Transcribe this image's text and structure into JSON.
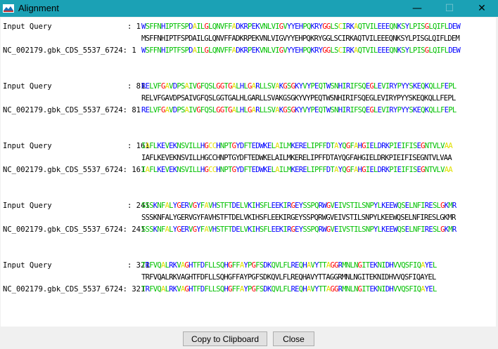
{
  "window": {
    "title": "Alignment",
    "minimize_glyph": "—",
    "maximize_glyph": "☐",
    "close_glyph": "✕"
  },
  "colors": {
    "titlebar": "#1ba1b5",
    "green": "#00c000",
    "blue": "#0000ff",
    "red": "#ff0000",
    "yellow": "#e0e000",
    "black": "#000000"
  },
  "alignment": {
    "blocks": [
      {
        "query_label": "Input Query                 : 1",
        "query_seq": "WSFFNHIPTFSPDAILGLQNVFFADKRPEKVNLVIGVYYEHPQKRYGGLSCIRKAQTVILEEEQNKSYLPISGLQIFLDEW",
        "consensus": "MSFFNHIPTFSPDAILGLQNVFFADKRPEKVNLVIGVYYEHPQKRYGGLSCIRKAQTVILEEEQNKSYLPISGLQIFLDEM",
        "subject_label": "NC_002179.gbk_CDS_5537_6724: 1",
        "subject_seq": "WSFFNHIPTFSPDAILGLQNVFFADKRPEKVNLVIGVYYEHPQKRYGGLSCIRKAQTVILEEEQNKSYLPISGLQIFLDEW"
      },
      {
        "query_label": "Input Query                 : 81",
        "query_seq": "RELVFGAVDPSAIVGFQSLGGTGALHLGARLLSVAKGSGKYVYPEQTWSNHIRIFSQEGLEVIRYPYYSKEQKQLLFEPL",
        "consensus": "RELVFGAVDPSAIVGFQSLGGTGALHLGARLLSVAKGSGKYVYPEQTWSNHIRIFSQEGLEVIRYPYYSKEQKQLLFEPL",
        "subject_label": "NC_002179.gbk_CDS_5537_6724: 81",
        "subject_seq": "RELVFGAVDPSAIVGFQSLGGTGALHLGARLLSVAKGSGKYVYPEQTWSNHIRIFSQEGLEVIRYPYYSKEQKQLLFEPL"
      },
      {
        "query_label": "Input Query                 : 161",
        "query_seq": "IAFLKEVEKNSVILLHGCCHNPTGYDFTEDWKELAILMKERELIPFFDTAYQGFAHGIELDRKPIEIFISEGNTVLVAA",
        "consensus": "IAFLKEVEKNSVILLHGCCHNPTGYDFTEDWKELAILMKERELIPFFDTAYQGFAHGIELDRKPIEIFISEGNTVLVAA",
        "subject_label": "NC_002179.gbk_CDS_5537_6724: 161",
        "subject_seq": "IAFLKEVEKNSVILLHGCCHNPTGYDFTEDWKELAILMKERELIPFFDTAYQGFAHGIELDRKPIEIFISEGNTVLVAA"
      },
      {
        "query_label": "Input Query                 : 241",
        "query_seq": "SSSKNFALYGERVGYFAVHSTFTDELVKIHSFLEEKIRGEYSSPQRWGVEIVSTILSNPYLKEEWQSELNFIRESLGKMR",
        "consensus": "SSSKNFALYGERVGYFAVHSTFTDELVKIHSFLEEKIRGEYSSPQRWGVEIVSTILSNPYLKEEWQSELNFIRESLGKMR",
        "subject_label": "NC_002179.gbk_CDS_5537_6724: 241",
        "subject_seq": "SSSKNFALYGERVGYFAVHSTFTDELVKIHSFLEEKIRGEYSSPQRWGVEIVSTILSNPYLKEEWQSELNFIRESLGKMR"
      },
      {
        "query_label": "Input Query                 : 321",
        "query_seq": "TRFVQALRKVAGHTFDFLLSQHGFFAYPGFSDKQVLFLREQHAVYTTAGGRMNLNGITEKNIDHVVQSFIQAYEL",
        "consensus": "TRFVQALRKVAGHTFDFLLSQHGFFAYPGFSDKQVLFLREQHAVYTTAGGRMNLNGITEKNIDHVVQSFIQAYEL",
        "subject_label": "NC_002179.gbk_CDS_5537_6724: 321",
        "subject_seq": "TRFVQALRKVAGHTFDFLLSQHGFFAYPGFSDKQVLFLREQHAVYTTAGGRMNLNGITEKNIDHVVQSFIQAYEL"
      }
    ]
  },
  "buttons": {
    "copy": "Copy to Clipboard",
    "close": "Close"
  }
}
